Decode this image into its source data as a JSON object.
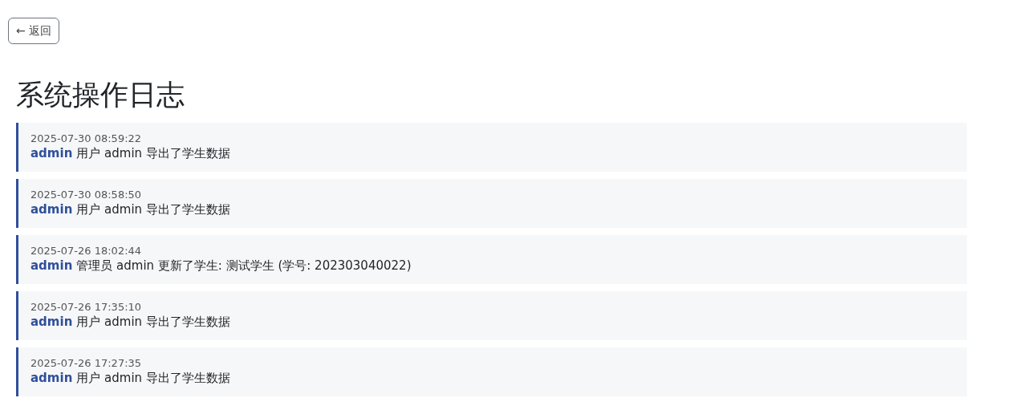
{
  "back_button": {
    "label": "← 返回"
  },
  "title": "系统操作日志",
  "logs": [
    {
      "time": "2025-07-30 08:59:22",
      "user": "admin",
      "message": "用户 admin 导出了学生数据"
    },
    {
      "time": "2025-07-30 08:58:50",
      "user": "admin",
      "message": "用户 admin 导出了学生数据"
    },
    {
      "time": "2025-07-26 18:02:44",
      "user": "admin",
      "message": "管理员 admin 更新了学生: 测试学生 (学号: 202303040022)"
    },
    {
      "time": "2025-07-26 17:35:10",
      "user": "admin",
      "message": "用户 admin 导出了学生数据"
    },
    {
      "time": "2025-07-26 17:27:35",
      "user": "admin",
      "message": "用户 admin 导出了学生数据"
    }
  ]
}
